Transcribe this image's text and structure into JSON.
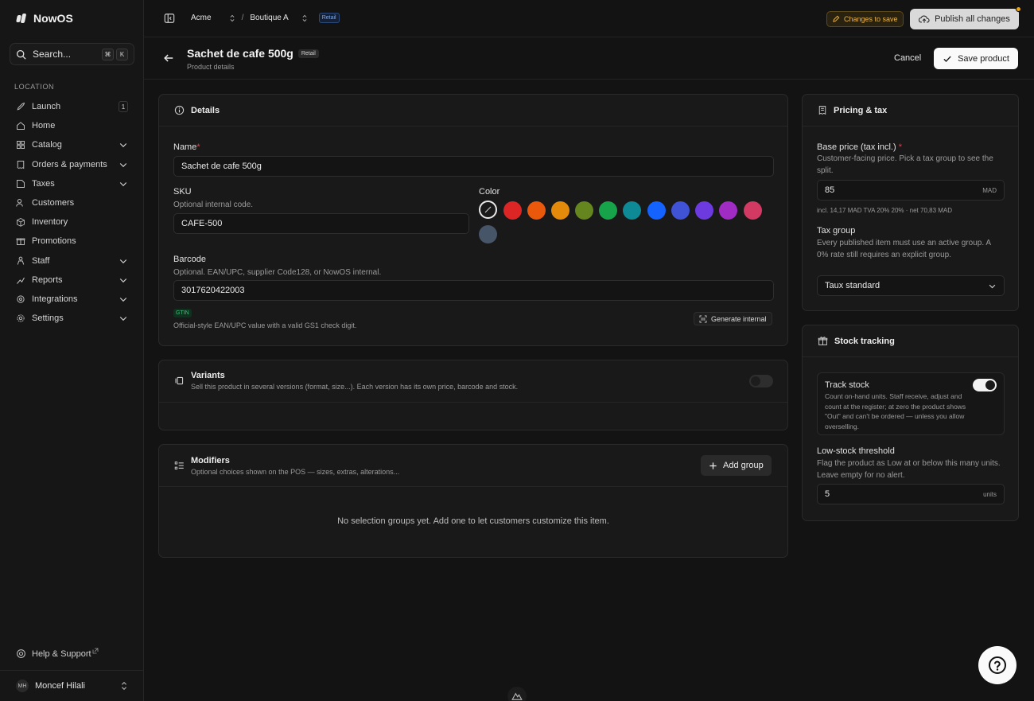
{
  "app": {
    "name": "NowOS"
  },
  "search": {
    "label": "Search...",
    "kbd": [
      "⌘",
      "K"
    ]
  },
  "sidebar": {
    "section_label": "LOCATION",
    "items": [
      {
        "label": "Launch",
        "icon": "rocket-icon",
        "badge": "1"
      },
      {
        "label": "Home",
        "icon": "home-icon"
      },
      {
        "label": "Catalog",
        "icon": "grid-icon",
        "expandable": true
      },
      {
        "label": "Orders & payments",
        "icon": "receipt-icon",
        "expandable": true
      },
      {
        "label": "Taxes",
        "icon": "percent-icon",
        "expandable": true
      },
      {
        "label": "Customers",
        "icon": "users-icon"
      },
      {
        "label": "Inventory",
        "icon": "box-icon"
      },
      {
        "label": "Promotions",
        "icon": "gift-icon"
      },
      {
        "label": "Staff",
        "icon": "staff-icon",
        "expandable": true
      },
      {
        "label": "Reports",
        "icon": "chart-icon",
        "expandable": true
      },
      {
        "label": "Integrations",
        "icon": "plug-icon",
        "expandable": true
      },
      {
        "label": "Settings",
        "icon": "gear-icon",
        "expandable": true
      }
    ],
    "help": "Help & Support",
    "user": {
      "initials": "MH",
      "name": "Moncef Hilali"
    }
  },
  "topbar": {
    "org": "Acme",
    "separator": "/",
    "location": "Boutique A",
    "location_badge": "Retail",
    "changes_pill": "Changes to save",
    "publish_label": "Publish all changes"
  },
  "header": {
    "title": "Sachet de cafe 500g",
    "badge": "Retail",
    "subtitle": "Product details",
    "cancel_label": "Cancel",
    "save_label": "Save product"
  },
  "details": {
    "title": "Details",
    "name_label": "Name",
    "name_value": "Sachet de cafe 500g",
    "sku_label": "SKU",
    "sku_hint": "Optional internal code.",
    "sku_value": "CAFE-500",
    "color_label": "Color",
    "colors": [
      "#dc2626",
      "#ea580c",
      "#e48a0b",
      "#65851f",
      "#16a34a",
      "#0e8a96",
      "#1463ff",
      "#4052d6",
      "#6d3ae0",
      "#a02cc4",
      "#d23a63",
      "#475569"
    ],
    "barcode_label": "Barcode",
    "barcode_hint": "Optional. EAN/UPC, supplier Code128, or NowOS internal.",
    "barcode_value": "3017620422003",
    "gtin_badge": "GTIN",
    "gtin_hint": "Official-style EAN/UPC value with a valid GS1 check digit.",
    "generate_label": "Generate internal"
  },
  "variants": {
    "title": "Variants",
    "hint": "Sell this product in several versions (format, size...). Each version has its own price, barcode and stock.",
    "enabled": false
  },
  "modifiers": {
    "title": "Modifiers",
    "hint": "Optional choices shown on the POS — sizes, extras, alterations...",
    "add_label": "Add group",
    "empty": "No selection groups yet. Add one to let customers customize this item."
  },
  "pricing": {
    "title": "Pricing & tax",
    "base_label": "Base price (tax incl.)",
    "base_hint": "Customer-facing price. Pick a tax group to see the split.",
    "base_value": "85",
    "currency": "MAD",
    "breakdown": "incl. 14,17 MAD TVA 20% 20% · net 70,83 MAD",
    "taxgroup_label": "Tax group",
    "taxgroup_hint": "Every published item must use an active group. A 0% rate still requires an explicit group.",
    "taxgroup_value": "Taux standard"
  },
  "stock": {
    "title": "Stock tracking",
    "track_label": "Track stock",
    "track_hint": "Count on-hand units. Staff receive, adjust and count at the register; at zero the product shows \"Out\" and can't be ordered — unless you allow overselling.",
    "track_enabled": true,
    "threshold_label": "Low-stock threshold",
    "threshold_hint": "Flag the product as Low at or below this many units. Leave empty for no alert.",
    "threshold_value": "5",
    "threshold_unit": "units"
  }
}
